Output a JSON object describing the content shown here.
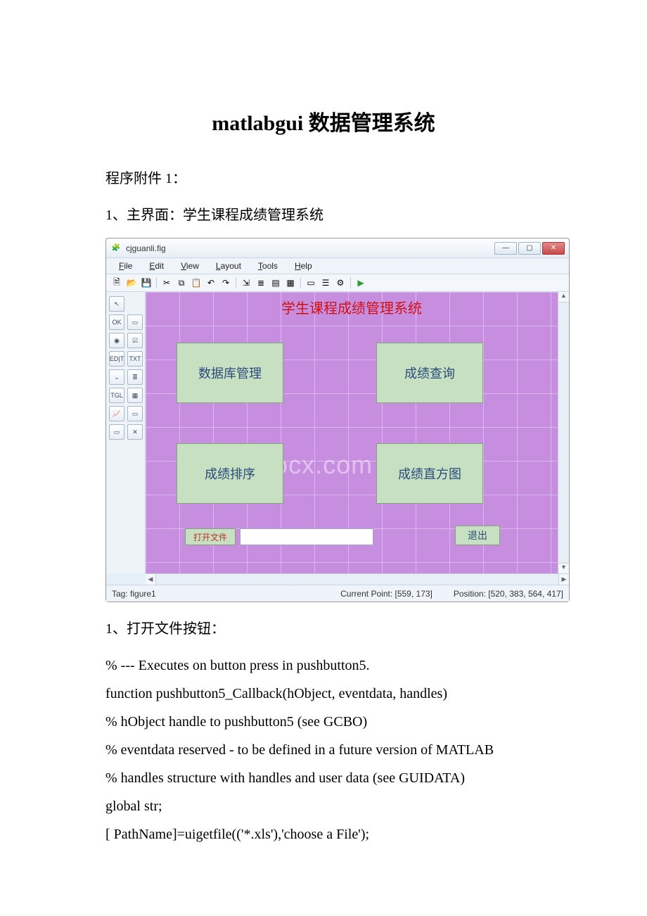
{
  "page": {
    "title": "matlabgui 数据管理系统",
    "appendix_label": "程序附件 1：",
    "section1": "1、主界面：学生课程成绩管理系统",
    "section2": "1、打开文件按钮：",
    "watermark": "www.bdocx.com"
  },
  "window": {
    "title": "cjguanli.fig",
    "controls": {
      "min": "—",
      "max": "▢",
      "close": "✕"
    }
  },
  "menubar": {
    "file": "File",
    "edit": "Edit",
    "view": "View",
    "layout": "Layout",
    "tools": "Tools",
    "help": "Help"
  },
  "toolbar_icons": {
    "new": "🗎",
    "open": "📂",
    "save": "💾",
    "cut": "✂",
    "copy": "⧉",
    "paste": "📋",
    "undo": "↶",
    "redo": "↷",
    "align": "⇲",
    "dist": "≣",
    "menu_ed": "▤",
    "tab_ed": "▦",
    "tool_ed": "▭",
    "prop": "☰",
    "obj": "⚙",
    "run": "▶"
  },
  "palette": {
    "select": "↖",
    "push": "OK",
    "slider": "▭",
    "radio": "◉",
    "check": "☑",
    "edit": "ED|T",
    "text": "TXT",
    "popup": "⌄",
    "list": "≣",
    "toggle": "TGL",
    "table": "▦",
    "axes": "📈",
    "panel": "▭",
    "bgroup": "▭",
    "activex": "✕"
  },
  "canvas": {
    "system_title": "学生课程成绩管理系统",
    "btn_db": "数据库管理",
    "btn_query": "成绩查询",
    "btn_sort": "成绩排序",
    "btn_hist": "成绩直方图",
    "btn_open": "打开文件",
    "btn_exit": "退出"
  },
  "statusbar": {
    "tag": "Tag: figure1",
    "current_point": "Current Point:  [559, 173]",
    "position": "Position: [520, 383, 564, 417]"
  },
  "code": {
    "l1": "% --- Executes on button press in pushbutton5.",
    "l2": "function pushbutton5_Callback(hObject, eventdata, handles)",
    "l3": "% hObject handle to pushbutton5 (see GCBO)",
    "l4": "% eventdata reserved - to be defined in a future version of MATLAB",
    "l5": "% handles structure with handles and user data (see GUIDATA)",
    "l6": "global str;",
    "l7": "[ PathName]=uigetfile(('*.xls'),'choose a File');"
  }
}
